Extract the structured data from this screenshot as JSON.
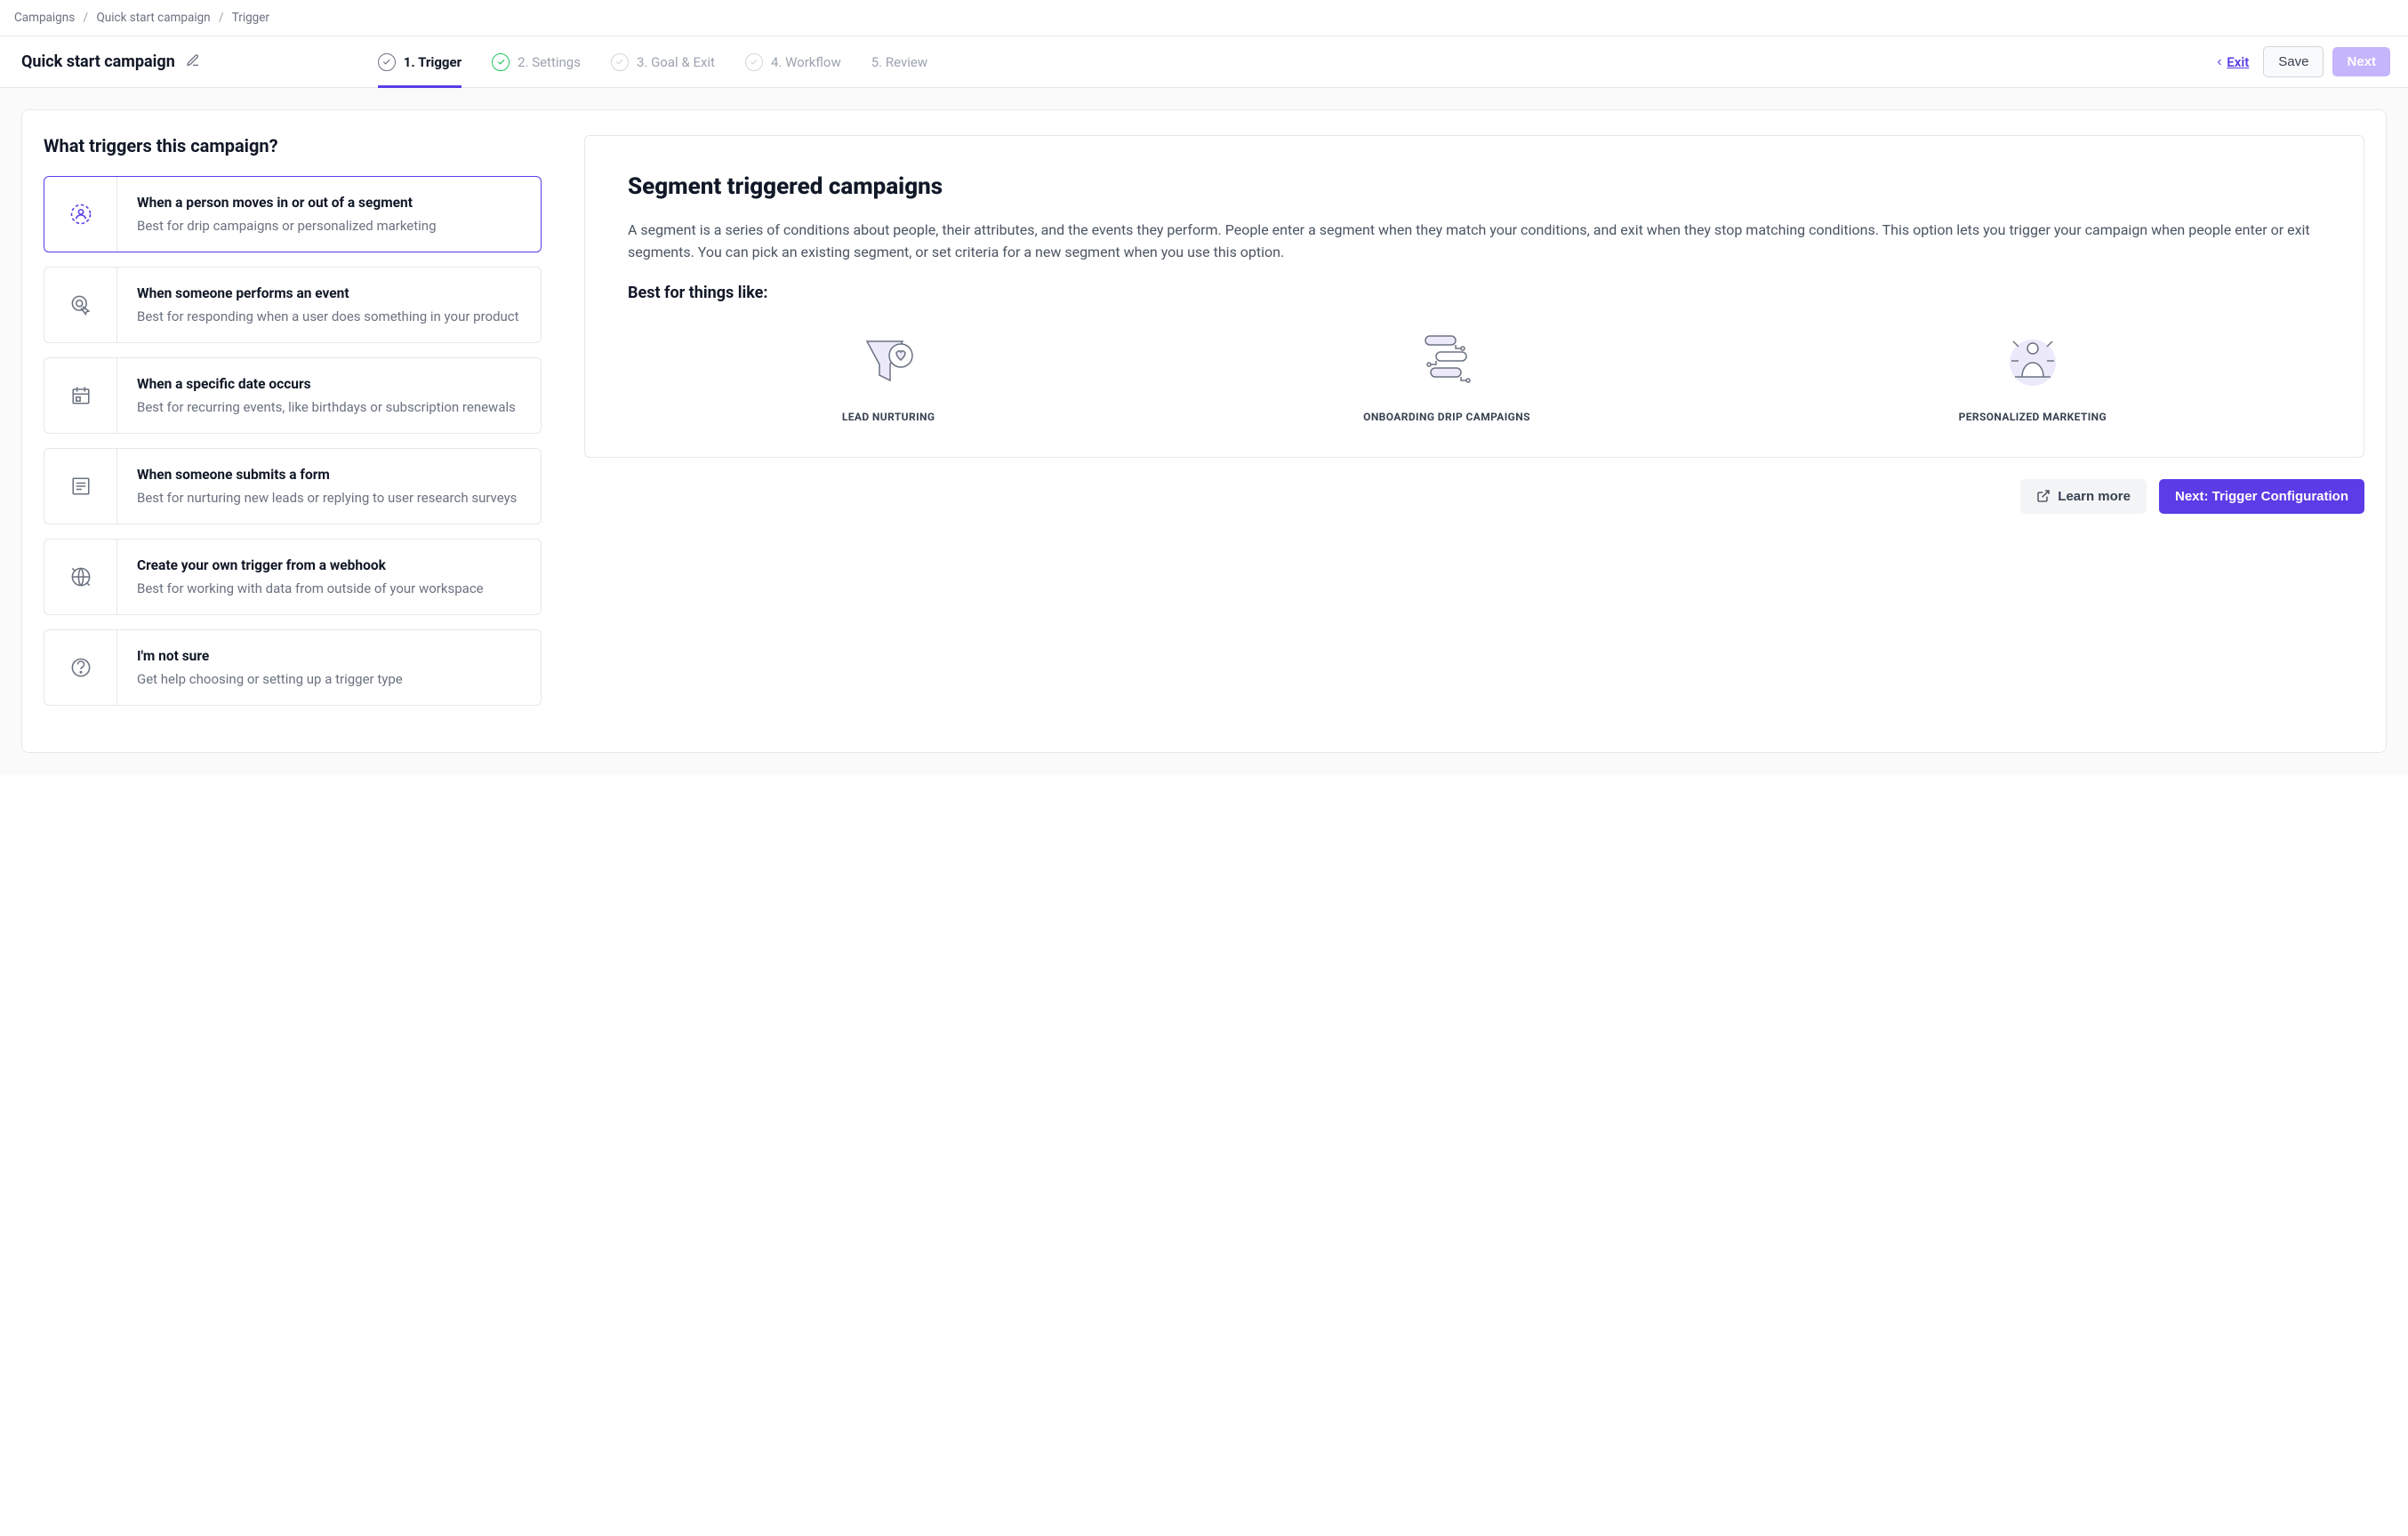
{
  "breadcrumb": {
    "items": [
      "Campaigns",
      "Quick start campaign",
      "Trigger"
    ]
  },
  "header": {
    "title": "Quick start campaign",
    "steps": [
      {
        "label": "1. Trigger",
        "state": "active"
      },
      {
        "label": "2. Settings",
        "state": "done"
      },
      {
        "label": "3. Goal & Exit",
        "state": "pending"
      },
      {
        "label": "4. Workflow",
        "state": "pending"
      },
      {
        "label": "5. Review",
        "state": "plain"
      }
    ],
    "exit": "Exit",
    "save": "Save",
    "next": "Next"
  },
  "triggers": {
    "heading": "What triggers this campaign?",
    "options": [
      {
        "id": "segment",
        "title": "When a person moves in or out of a segment",
        "desc": "Best for drip campaigns or personalized marketing",
        "selected": true
      },
      {
        "id": "event",
        "title": "When someone performs an event",
        "desc": "Best for responding when a user does something in your product",
        "selected": false
      },
      {
        "id": "date",
        "title": "When a specific date occurs",
        "desc": "Best for recurring events, like birthdays or subscription renewals",
        "selected": false
      },
      {
        "id": "form",
        "title": "When someone submits a form",
        "desc": "Best for nurturing new leads or replying to user research surveys",
        "selected": false
      },
      {
        "id": "webhook",
        "title": "Create your own trigger from a webhook",
        "desc": "Best for working with data from outside of your workspace",
        "selected": false
      },
      {
        "id": "help",
        "title": "I'm not sure",
        "desc": "Get help choosing or setting up a trigger type",
        "selected": false
      }
    ]
  },
  "detail": {
    "heading": "Segment triggered campaigns",
    "body": "A segment is a series of conditions about people, their attributes, and the events they perform. People enter a segment when they match your conditions, and exit when they stop matching conditions. This option lets you trigger your campaign when people enter or exit segments. You can pick an existing segment, or set criteria for a new segment when you use this option.",
    "best_for_heading": "Best for things like:",
    "best_for": [
      "LEAD NURTURING",
      "ONBOARDING DRIP CAMPAIGNS",
      "PERSONALIZED MARKETING"
    ],
    "learn_more": "Learn more",
    "next_cta": "Next: Trigger Configuration"
  }
}
